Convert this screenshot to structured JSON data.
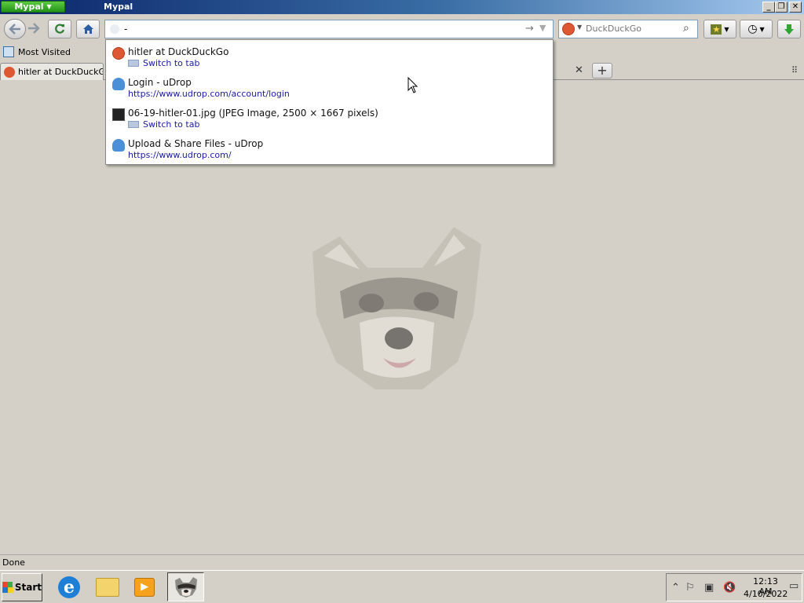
{
  "window": {
    "app_menu_label": "Mypal",
    "title": "Mypal",
    "controls": {
      "minimize": "_",
      "restore": "❐",
      "close": "✕"
    }
  },
  "navbar": {
    "back_icon": "back-arrow-icon",
    "forward_icon": "forward-arrow-icon",
    "reload_icon": "reload-icon",
    "home_icon": "home-icon",
    "url_value": "-",
    "search_engine": "DuckDuckGo",
    "search_placeholder": "DuckDuckGo",
    "go_glyph": "→",
    "dropdown_glyph": "▼",
    "search_glyph": "⌕"
  },
  "bookmarks": {
    "items": [
      {
        "label": "Most Visited"
      }
    ]
  },
  "tabs": {
    "items": [
      {
        "label": "hitler at DuckDuckGo",
        "favicon": "duckduckgo-icon"
      }
    ],
    "close_glyph": "✕",
    "new_tab_glyph": "+",
    "list_glyph": "⠿"
  },
  "autocomplete": {
    "items": [
      {
        "title": "hitler at DuckDuckGo",
        "subtitle": "Switch to tab",
        "icon": "duckduckgo-icon",
        "kind": "switch"
      },
      {
        "title": "Login - uDrop",
        "subtitle": "https://www.udrop.com/account/login",
        "icon": "cloud-upload-icon",
        "kind": "url"
      },
      {
        "title": "06-19-hitler-01.jpg (JPEG Image, 2500 × 1667 pixels)",
        "subtitle": "Switch to tab",
        "icon": "image-thumbnail-icon",
        "kind": "switch"
      },
      {
        "title": "Upload & Share Files - uDrop",
        "subtitle": "https://www.udrop.com/",
        "icon": "cloud-upload-icon",
        "kind": "url"
      }
    ]
  },
  "status": {
    "text": "Done"
  },
  "taskbar": {
    "start_label": "Start",
    "clock_time": "12:13 AM",
    "clock_date": "4/10/2022"
  },
  "colors": {
    "titlebar_start": "#0a246a",
    "titlebar_end": "#a6caf0",
    "chrome": "#d4d0c8",
    "link": "#1a1aa6",
    "ddg_brand": "#de5833",
    "app_menu": "#23951a"
  }
}
